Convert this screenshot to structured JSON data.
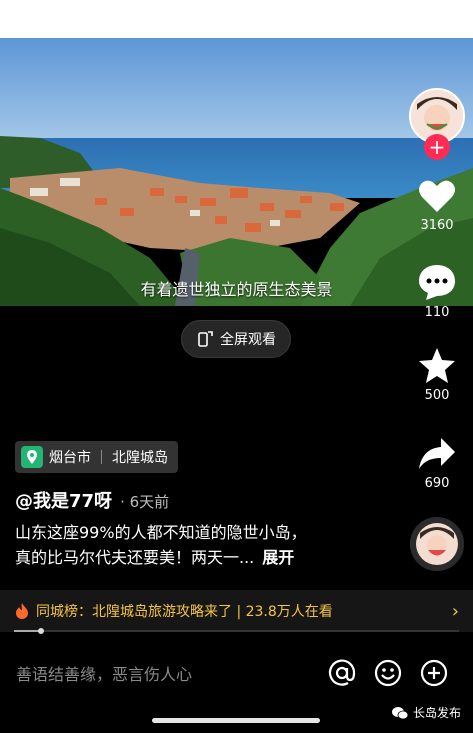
{
  "video": {
    "subtitle": "有着遗世独立的原生态美景",
    "fullscreen_label": "全屏观看"
  },
  "sidebar": {
    "likes": "3160",
    "comments": "110",
    "favorites": "500",
    "shares": "690"
  },
  "location": {
    "city": "烟台市",
    "place": "北隍城岛"
  },
  "post": {
    "author": "@我是77呀",
    "time": "6天前",
    "desc_line1": "山东这座99%的人都不知道的隐世小岛，",
    "desc_line2": "真的比马尔代夫还要美！两天一...",
    "expand": "展开"
  },
  "banner": {
    "label": "同城榜：北隍城岛旅游攻略来了 | 23.8万人在看"
  },
  "playback": {
    "progress": 0.06
  },
  "comment_bar": {
    "placeholder": "善语结善缘，恶言伤人心"
  },
  "watermark": {
    "text": "长岛发布"
  },
  "colors": {
    "accent": "#fe2c55",
    "banner_text": "#f5c542"
  }
}
